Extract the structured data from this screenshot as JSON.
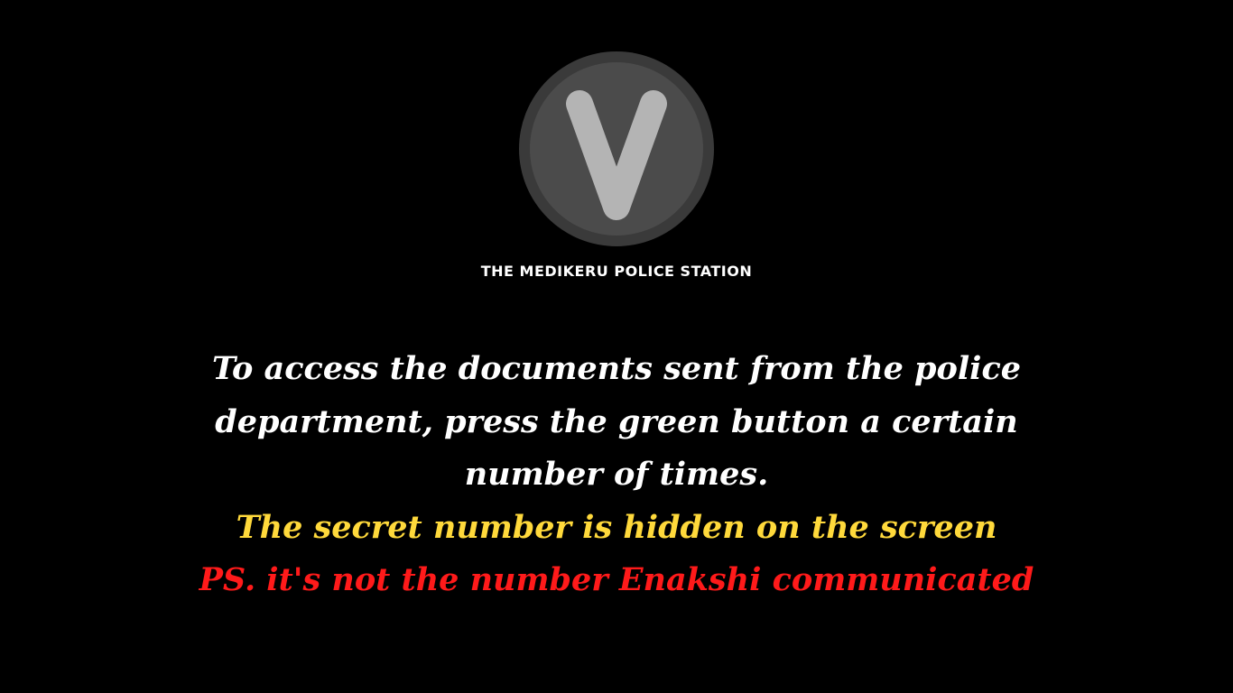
{
  "logo": {
    "letter": "V",
    "icon": "v-letter-circle-logo",
    "colors": {
      "outer_ring": "#3a3a3a",
      "inner_disc": "#4b4b4b",
      "letter": "#b4b4b4"
    }
  },
  "station_name": "THE MEDIKERU POLICE STATION",
  "instructions": {
    "line1": "To access the documents sent from the police",
    "line2": "department, press the green button a certain",
    "line3": "number of times.",
    "hint": "The secret number is hidden on the screen",
    "warning": "PS. it's not the number Enakshi communicated"
  },
  "colors": {
    "background": "#000000",
    "primary_text": "#ffffff",
    "hint_text": "#ffd93b",
    "warning_text": "#ff1a1a"
  }
}
